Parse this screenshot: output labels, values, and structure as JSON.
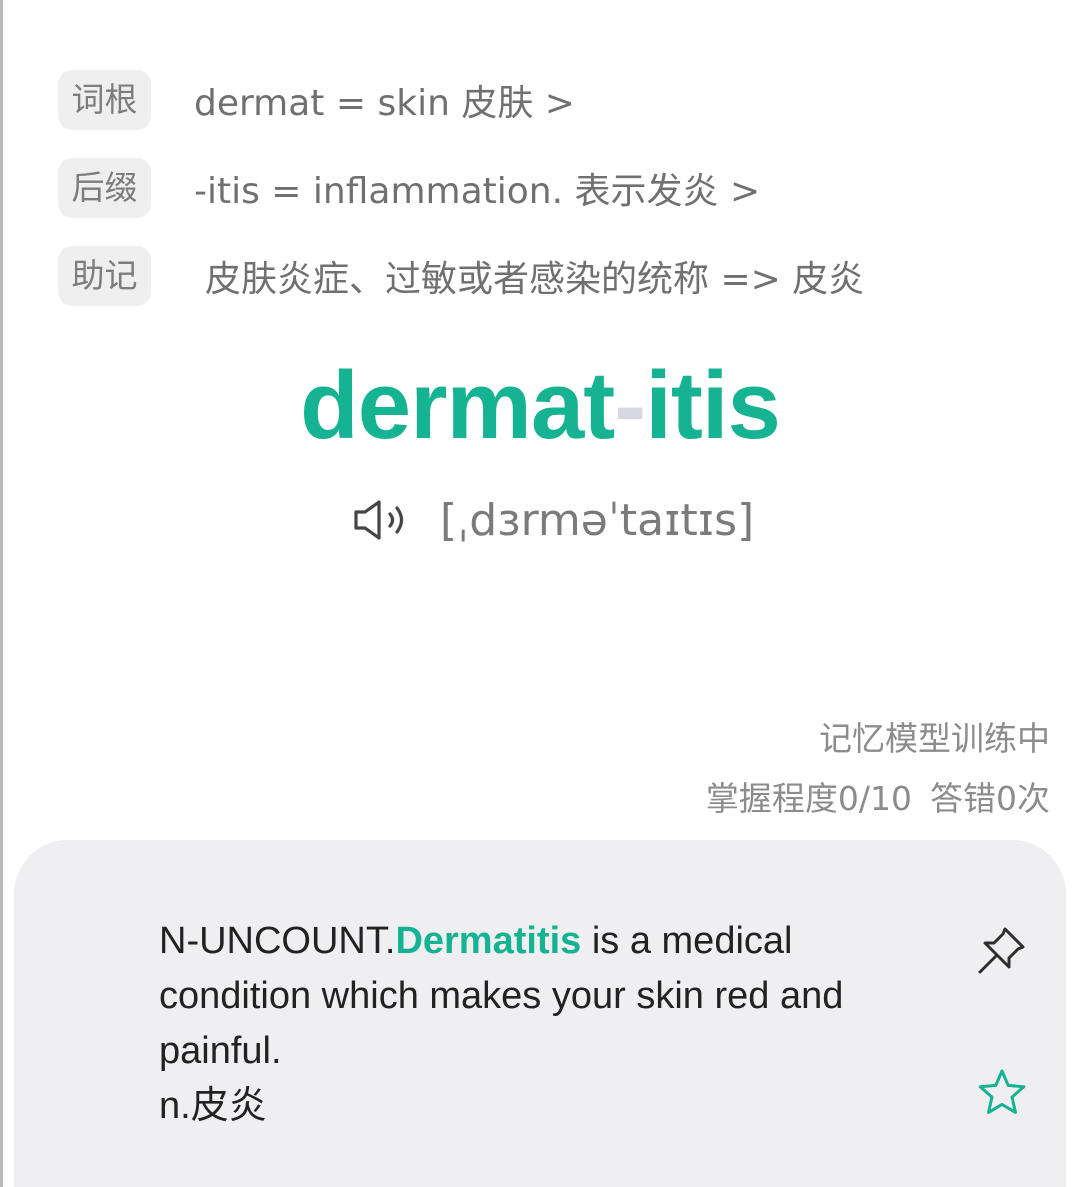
{
  "rows": [
    {
      "tag": "词根",
      "text": "dermat = skin 皮肤 >"
    },
    {
      "tag": "后缀",
      "text": "-itis = inflammation. 表示发炎 >"
    },
    {
      "tag": "助记",
      "text": "皮肤炎症、过敏或者感染的统称 => 皮炎"
    }
  ],
  "word": {
    "root": "dermat",
    "hyphen": "-",
    "suffix": "itis"
  },
  "pronunciation": {
    "icon": "speaker-icon",
    "phonetic": "[ˌdɜrməˈtaɪtɪs]"
  },
  "status": {
    "line1": "记忆模型训练中",
    "mastery": "掌握程度0/10",
    "errors": "答错0次"
  },
  "definition": {
    "label": "N-UNCOUNT.",
    "highlight": "Dermatitis",
    "rest": " is a medical condition which makes your skin red and painful.",
    "chinese": "n.皮炎"
  },
  "icons": {
    "pin": "pin-icon",
    "star": "star-icon"
  },
  "colors": {
    "accent": "#15b391",
    "hyphen": "#d8d8e0",
    "tag_bg": "#efefef",
    "card_bg": "#efeff1"
  }
}
